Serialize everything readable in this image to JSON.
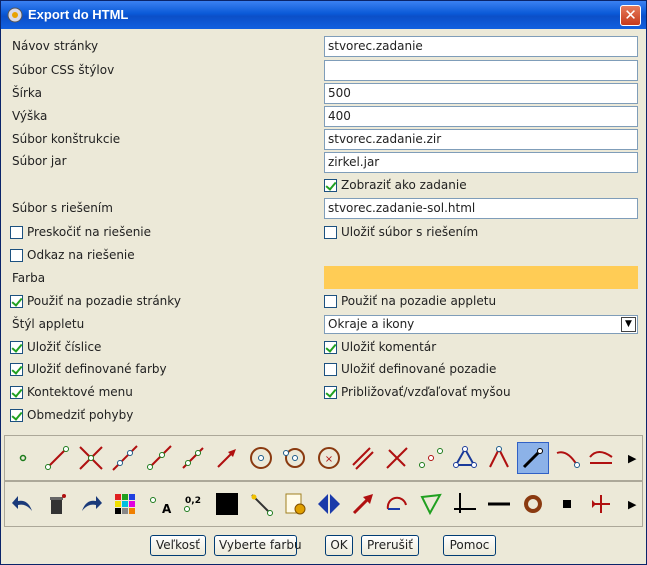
{
  "window": {
    "title": "Export do HTML",
    "close_label": "✕"
  },
  "form": {
    "page_name_label": "Návov stránky",
    "page_name_value": "stvorec.zadanie",
    "css_file_label": "Súbor CSS štýlov",
    "css_file_value": "",
    "width_label": "Šírka",
    "width_value": "500",
    "height_label": "Výška",
    "height_value": "400",
    "construction_file_label": "Súbor konštrukcie",
    "construction_file_value": "stvorec.zadanie.zir",
    "jar_file_label": "Súbor jar",
    "jar_file_value": "zirkel.jar",
    "show_as_task_label": "Zobraziť ako zadanie",
    "solution_file_label": "Súbor s riešením",
    "solution_file_value": "stvorec.zadanie-sol.html",
    "skip_solution_label": "Preskočiť na riešenie",
    "save_solution_file_label": "Uložiť súbor s riešením",
    "link_solution_label": "Odkaz na riešenie",
    "color_label": "Farba",
    "use_page_bg_label": "Použiť na pozadie stránky",
    "use_applet_bg_label": "Použiť na pozadie appletu",
    "applet_style_label": "Štýl appletu",
    "applet_style_value": "Okraje a ikony",
    "save_digits_label": "Uložiť číslice",
    "save_comment_label": "Uložiť komentár",
    "save_defined_colors_label": "Uložiť definované farby",
    "save_defined_bg_label": "Uložiť definované pozadie",
    "context_menu_label": "Kontektové menu",
    "zoom_mouse_label": "Približovať/vzďaľovať myšou",
    "limit_moves_label": "Obmedziť pohyby"
  },
  "checkboxes": {
    "show_as_task": true,
    "skip_solution": false,
    "save_solution_file": false,
    "link_solution": false,
    "use_page_bg": true,
    "use_applet_bg": false,
    "save_digits": true,
    "save_comment": true,
    "save_defined_colors": true,
    "save_defined_bg": false,
    "context_menu": true,
    "zoom_mouse": true,
    "limit_moves": true
  },
  "colors": {
    "swatch": "#ffcc55"
  },
  "toolbar1": {
    "icons": [
      "point-icon",
      "segment-icon",
      "intersection-icon",
      "line-icon",
      "ray-icon",
      "parallel-icon",
      "vector-icon",
      "circle-icon",
      "circle-two-points-icon",
      "circle-fixed-icon",
      "parallel-lines-icon",
      "perpendicular-icon",
      "midpoint-icon",
      "polygon-icon",
      "angle-icon",
      "move-icon",
      "arc-icon",
      "function-icon"
    ],
    "more_label": "▶"
  },
  "toolbar2": {
    "icons": [
      "undo-icon",
      "delete-icon",
      "redo-icon",
      "color-palette-icon",
      "point-label-icon",
      "number-display-icon",
      "black-square-icon",
      "magic-wand-icon",
      "macro-icon",
      "flip-icon",
      "arrow-icon",
      "arc-tool-icon",
      "triangle-icon",
      "coordinate-axes-icon",
      "line-thickness-icon",
      "circle-ring-icon",
      "small-square-icon",
      "transform-icon"
    ],
    "more_label": "▶"
  },
  "buttons": {
    "size": "Veľkosť",
    "choose_color": "Vyberte farbu",
    "ok": "OK",
    "cancel": "Prerušiť",
    "help": "Pomoc"
  }
}
